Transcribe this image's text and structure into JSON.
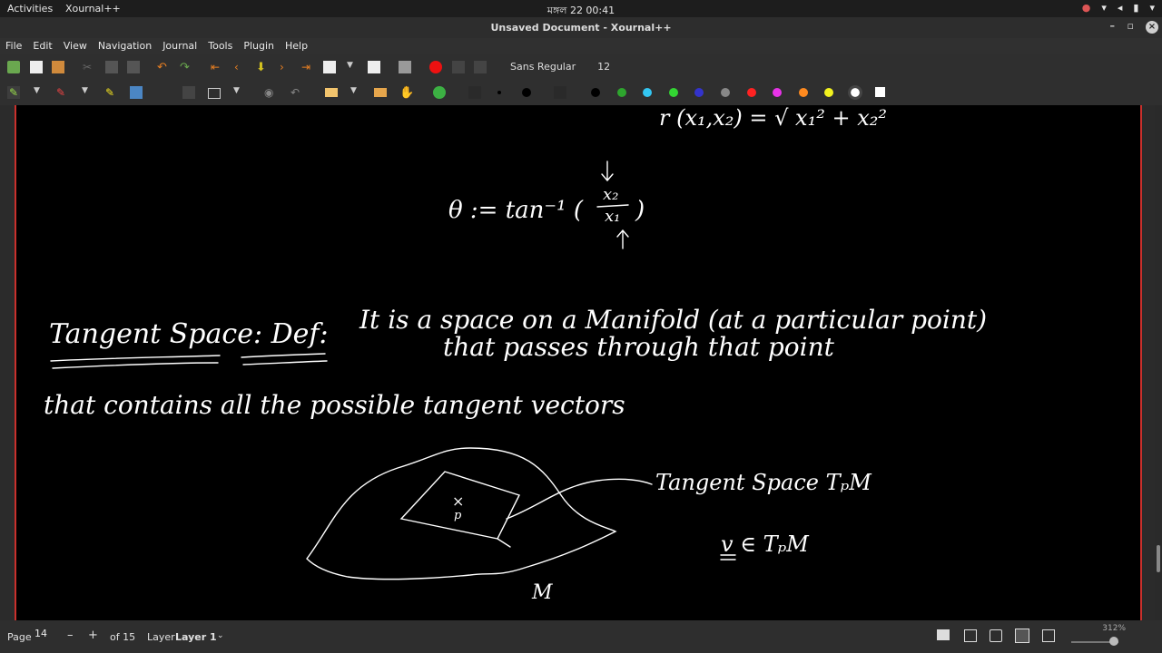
{
  "topbar": {
    "activities": "Activities",
    "app_name": "Xournal++",
    "clock": "মঙ্গল 22  00:41"
  },
  "window": {
    "title": "Unsaved Document - Xournal++"
  },
  "menu": {
    "items": [
      "File",
      "Edit",
      "View",
      "Navigation",
      "Journal",
      "Tools",
      "Plugin",
      "Help"
    ]
  },
  "toolbar": {
    "font_name": "Sans Regular",
    "font_size": "12"
  },
  "palette": {
    "colors": [
      "#000000",
      "#2ea52e",
      "#33c6f2",
      "#33d633",
      "#3333cc",
      "#888888",
      "#ff2222",
      "#e833e8",
      "#ff8a1f",
      "#f2f21f",
      "#ffffff",
      "#ffffff"
    ]
  },
  "note": {
    "line_top_eq": "r (x₁,x₂) = √ x₁² + x₂²",
    "theta_eq": "θ := tan⁻¹ ( x₂ / x₁ )",
    "frac_num": "x₂",
    "frac_den": "x₁",
    "heading": "Tangent Space: Def:",
    "line1": "It is a space on a Manifold (at a particular point)",
    "line2": "that passes through that point",
    "line3": "that contains all the possible tangent vectors",
    "label_tangent": "Tangent Space  TₚM",
    "label_vec": "v ∈ TₚM",
    "label_M": "M",
    "label_p": "p",
    "label_x": "×"
  },
  "status": {
    "page_label": "Page",
    "page_value": "14",
    "of_label": "of 15",
    "layer_label": "Layer",
    "layer_value": "Layer 1",
    "zoom": "312%"
  }
}
